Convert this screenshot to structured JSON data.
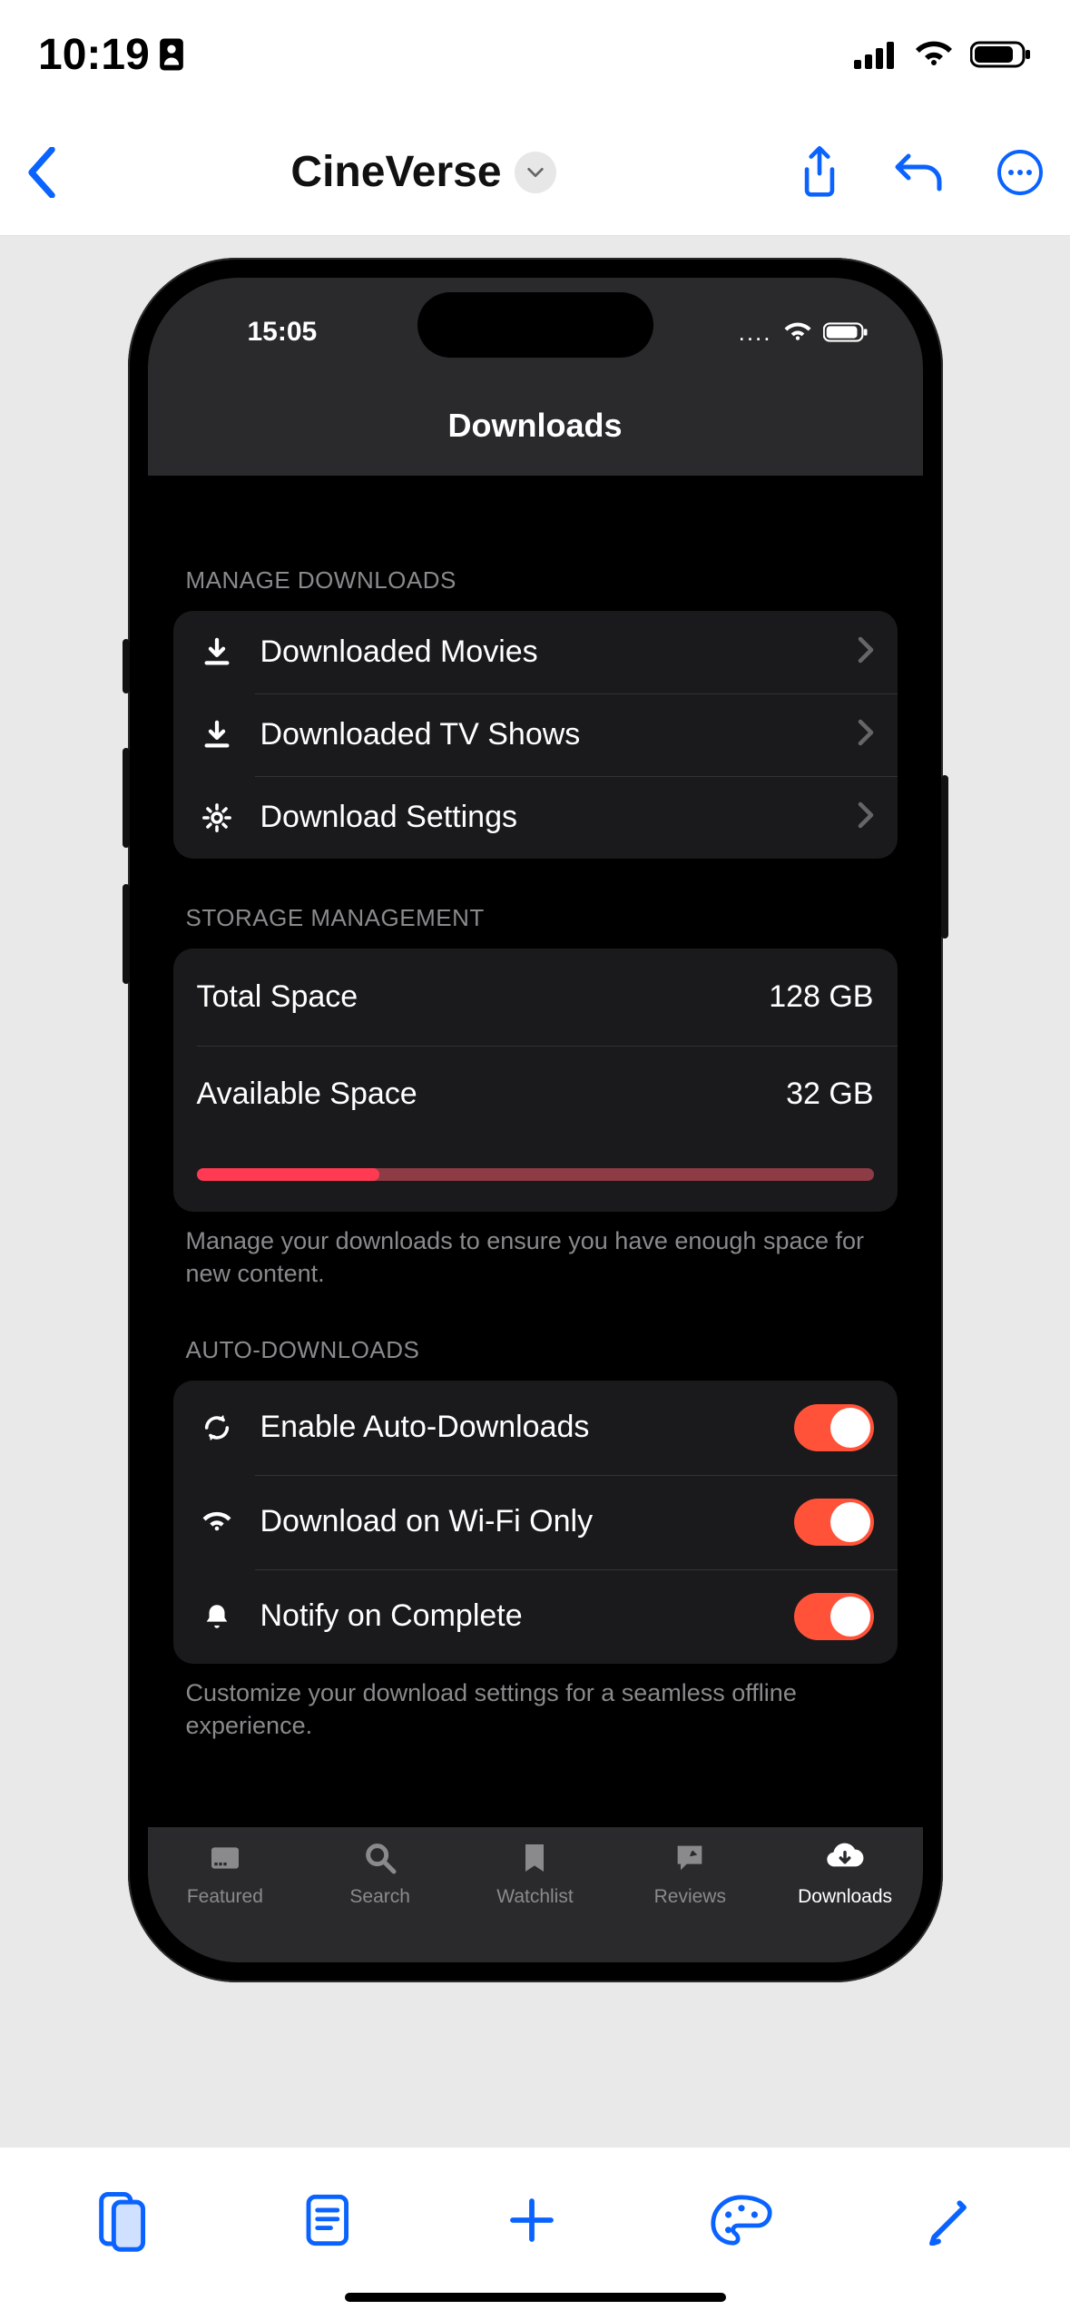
{
  "outerStatus": {
    "time": "10:19"
  },
  "outerNav": {
    "title": "CineVerse"
  },
  "app": {
    "status_time": "15:05",
    "title": "Downloads",
    "sections": {
      "manage": {
        "header": "MANAGE DOWNLOADS",
        "rows": {
          "movies": "Downloaded Movies",
          "tv": "Downloaded TV Shows",
          "settings": "Download Settings"
        }
      },
      "storage": {
        "header": "STORAGE MANAGEMENT",
        "total_label": "Total Space",
        "total_value": "128 GB",
        "avail_label": "Available Space",
        "avail_value": "32 GB",
        "progress_pct": 27,
        "footer": "Manage your downloads to ensure you have enough space for new content."
      },
      "auto": {
        "header": "AUTO-DOWNLOADS",
        "rows": {
          "enable": "Enable Auto-Downloads",
          "wifi": "Download on Wi-Fi Only",
          "notify": "Notify on Complete"
        },
        "footer": "Customize your download settings for a seamless offline experience."
      }
    },
    "tabs": {
      "featured": "Featured",
      "search": "Search",
      "watchlist": "Watchlist",
      "reviews": "Reviews",
      "downloads": "Downloads"
    }
  }
}
